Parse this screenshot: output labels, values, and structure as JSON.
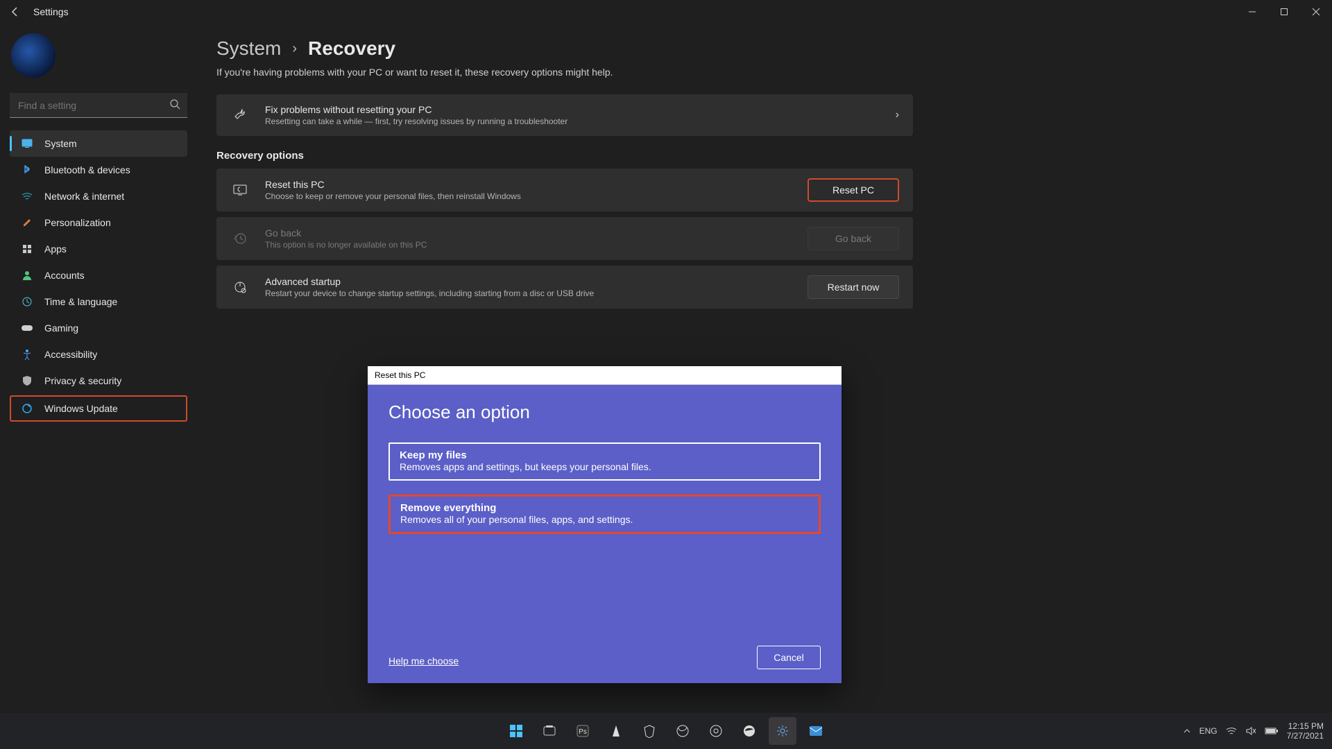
{
  "titlebar": {
    "app_name": "Settings"
  },
  "window_controls": {
    "minimize": "minimize",
    "maximize": "maximize",
    "close": "close"
  },
  "search": {
    "placeholder": "Find a setting"
  },
  "sidebar": {
    "items": [
      {
        "label": "System",
        "icon": "system-icon",
        "color": "#4cc2ff"
      },
      {
        "label": "Bluetooth & devices",
        "icon": "bluetooth-icon",
        "color": "#4aa3ff"
      },
      {
        "label": "Network & internet",
        "icon": "wifi-icon",
        "color": "#2fb8d6"
      },
      {
        "label": "Personalization",
        "icon": "brush-icon",
        "color": "#e27d3a"
      },
      {
        "label": "Apps",
        "icon": "apps-icon",
        "color": "#c8c8c8"
      },
      {
        "label": "Accounts",
        "icon": "person-icon",
        "color": "#4ec77e"
      },
      {
        "label": "Time & language",
        "icon": "globe-clock-icon",
        "color": "#5ac8e8"
      },
      {
        "label": "Gaming",
        "icon": "gamepad-icon",
        "color": "#d0d0d0"
      },
      {
        "label": "Accessibility",
        "icon": "accessibility-icon",
        "color": "#4aa3ff"
      },
      {
        "label": "Privacy & security",
        "icon": "shield-icon",
        "color": "#b0b0b0"
      },
      {
        "label": "Windows Update",
        "icon": "update-icon",
        "color": "#2fa8ff"
      }
    ]
  },
  "header": {
    "breadcrumb_parent": "System",
    "breadcrumb_page": "Recovery",
    "subtext": "If you're having problems with your PC or want to reset it, these recovery options might help."
  },
  "cards": {
    "fix": {
      "title": "Fix problems without resetting your PC",
      "desc": "Resetting can take a while — first, try resolving issues by running a troubleshooter"
    },
    "section_head": "Recovery options",
    "reset": {
      "title": "Reset this PC",
      "desc": "Choose to keep or remove your personal files, then reinstall Windows",
      "button": "Reset PC"
    },
    "goback": {
      "title": "Go back",
      "desc": "This option is no longer available on this PC",
      "button": "Go back"
    },
    "advanced": {
      "title": "Advanced startup",
      "desc": "Restart your device to change startup settings, including starting from a disc or USB drive",
      "button": "Restart now"
    }
  },
  "modal": {
    "window_title": "Reset this PC",
    "heading": "Choose an option",
    "options": [
      {
        "title": "Keep my files",
        "desc": "Removes apps and settings, but keeps your personal files."
      },
      {
        "title": "Remove everything",
        "desc": "Removes all of your personal files, apps, and settings."
      }
    ],
    "help": "Help me choose",
    "cancel": "Cancel"
  },
  "taskbar": {
    "tray": {
      "lang": "ENG",
      "time": "12:15 PM",
      "date": "7/27/2021"
    }
  }
}
